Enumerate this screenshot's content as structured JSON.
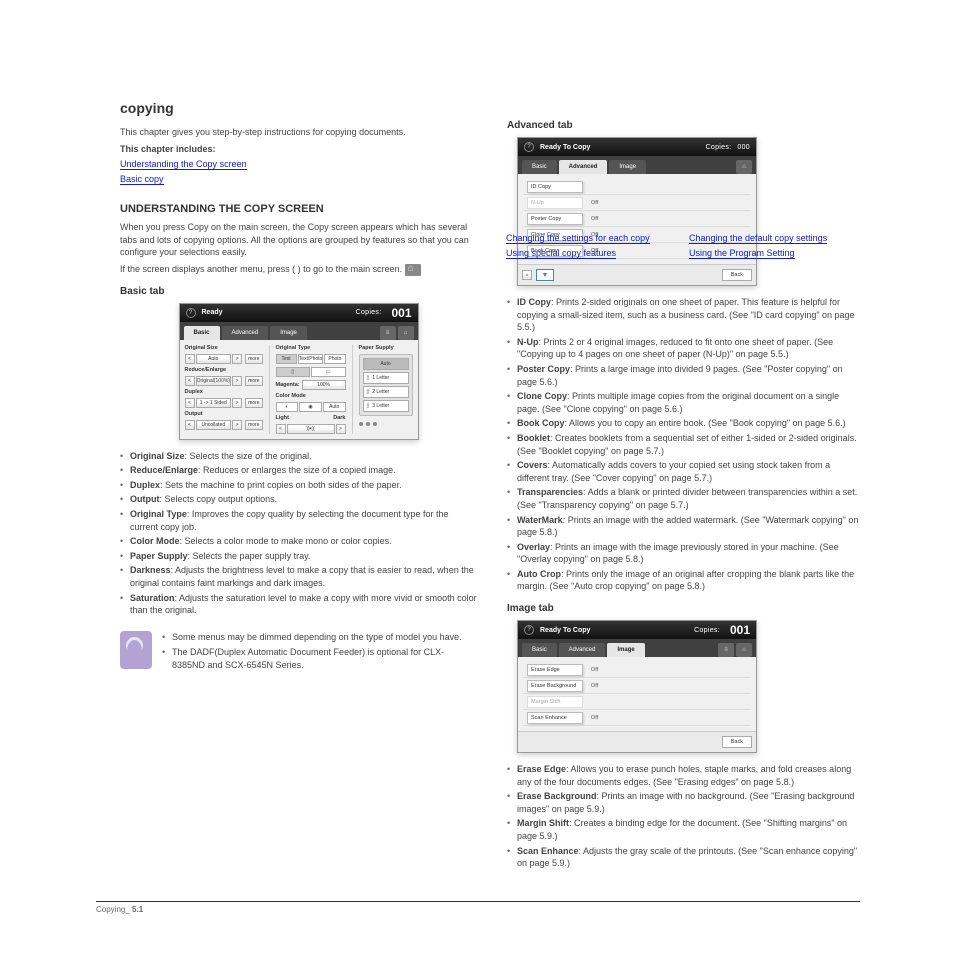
{
  "heading": "copying",
  "intro": "This chapter gives you step-by-step instructions for copying documents.",
  "chapter_includes_label": "This chapter includes:",
  "toc": [
    "Understanding the Copy screen",
    "Basic copy",
    "Changing the settings for each copy",
    "Using special copy features",
    "Changing the default copy settings",
    "Using the Program Setting"
  ],
  "s1": {
    "title": "UNDERSTANDING THE COPY SCREEN",
    "body": [
      "When you press Copy on the main screen, the Copy screen appears which has several tabs and lots of copying options. All the options are grouped by features so that you can configure your selections easily.",
      "If the screen displays another menu, press (    ) to go to the main screen."
    ]
  },
  "basic_tab": {
    "title": "Basic tab",
    "panel": {
      "status": "Ready",
      "copies_label": "Copies:",
      "copies_value": "001",
      "tabs": [
        "Basic",
        "Advanced",
        "Image"
      ],
      "left": {
        "original_size": {
          "label": "Original Size",
          "value": "Auto",
          "more": "more"
        },
        "reduce": {
          "label": "Reduce/Enlarge",
          "value": "Original(100%)",
          "more": "more"
        },
        "duplex": {
          "label": "Duplex",
          "value": "1 -> 1 Sided",
          "more": "more"
        },
        "output": {
          "label": "Output",
          "value": "Uncollated",
          "more": "more"
        }
      },
      "mid": {
        "original_type": {
          "label": "Original Type",
          "seg": [
            "Text",
            "Text/Photo",
            "Photo"
          ]
        },
        "orientation": {
          "label": "Orientation"
        },
        "magenta_label": "Magenta:",
        "magenta_value": "100%",
        "color_mode": {
          "label": "Color Mode",
          "auto": "Auto"
        },
        "darkness": {
          "label": "Light",
          "right": "Dark"
        }
      },
      "right": {
        "label": "Paper Supply",
        "auto": "Auto",
        "trays": [
          "1  Letter",
          "2  Letter",
          "3  Letter"
        ]
      }
    },
    "items": [
      {
        "k": "Original Size",
        "v": "Selects the size of the original."
      },
      {
        "k": "Reduce/Enlarge",
        "v": "Reduces or enlarges the size of a copied image."
      },
      {
        "k": "Duplex",
        "v": "Sets the machine to print copies on both sides of the paper."
      },
      {
        "k": "Output",
        "v": "Selects copy output options."
      },
      {
        "k": "Original Type",
        "v": "Improves the copy quality by selecting the document type for the current copy job."
      },
      {
        "k": "Color Mode",
        "v": "Selects a color mode to make mono or color copies."
      },
      {
        "k": "Paper Supply",
        "v": "Selects the paper supply tray."
      },
      {
        "k": "Darkness",
        "v": "Adjusts the brightness level to make a copy that is easier to read, when the original contains faint markings and dark images."
      },
      {
        "k": "Saturation",
        "v": "Adjusts the saturation level to make a copy with more vivid or smooth color than the original."
      }
    ],
    "note": [
      "Some menus may be dimmed depending on the type of model you have.",
      "The DADF(Duplex Automatic Document Feeder) is optional for CLX-8385ND and SCX-6545N Series."
    ]
  },
  "advanced_tab": {
    "title": "Advanced tab",
    "panel": {
      "status": "Ready To Copy",
      "copies_label": "Copies:",
      "copies_value": "000",
      "tabs": [
        "Basic",
        "Advanced",
        "Image"
      ],
      "rows": [
        {
          "label": "ID Copy",
          "val": ""
        },
        {
          "label": "N-Up",
          "val": "Off",
          "gray": true
        },
        {
          "label": "Poster Copy",
          "val": "Off"
        },
        {
          "label": "Clone Copy",
          "val": "Off"
        },
        {
          "label": "Book Copy",
          "val": "Off"
        }
      ],
      "back": "Back"
    },
    "items": [
      {
        "k": "ID Copy",
        "v": "Prints 2-sided originals on one sheet of paper. This feature is helpful for copying a small-sized item, such as a business card. (See \"ID card copying\" on page 5.5.)"
      },
      {
        "k": "N-Up",
        "v": "Prints 2 or 4 original images, reduced to fit onto one sheet of paper. (See \"Copying up to 4 pages on one sheet of paper (N-Up)\" on page 5.5.)"
      },
      {
        "k": "Poster Copy",
        "v": "Prints a large image into divided 9 pages. (See \"Poster copying\" on page 5.6.)"
      },
      {
        "k": "Clone Copy",
        "v": "Prints multiple image copies from the original document on a single page. (See \"Clone copying\" on page 5.6.)"
      },
      {
        "k": "Book Copy",
        "v": "Allows you to copy an entire book. (See \"Book copying\" on page 5.6.)"
      },
      {
        "k": "Booklet",
        "v": "Creates booklets from a sequential set of either 1-sided or 2-sided originals. (See \"Booklet copying\" on page 5.7.)"
      },
      {
        "k": "Covers",
        "v": "Automatically adds covers to your copied set using stock taken from a different tray. (See \"Cover copying\" on page 5.7.)"
      },
      {
        "k": "Transparencies",
        "v": "Adds a blank or printed divider between transparencies within a set. (See \"Transparency copying\" on page 5.7.)"
      },
      {
        "k": "WaterMark",
        "v": "Prints an image with the added watermark. (See \"Watermark copying\" on page 5.8.)"
      },
      {
        "k": "Overlay",
        "v": "Prints an image with the image previously stored in your machine. (See \"Overlay copying\" on page 5.8.)"
      },
      {
        "k": "Auto Crop",
        "v": "Prints only the image of an original after cropping the blank parts like the margin. (See \"Auto crop copying\" on page 5.8.)"
      }
    ]
  },
  "image_tab": {
    "title": "Image tab",
    "panel": {
      "status": "Ready To Copy",
      "copies_label": "Copies:",
      "copies_value": "001",
      "tabs": [
        "Basic",
        "Advanced",
        "Image"
      ],
      "rows": [
        {
          "label": "Erase Edge",
          "val": "Off"
        },
        {
          "label": "Erase Background",
          "val": "Off"
        },
        {
          "label": "Margin Shift",
          "val": "",
          "gray": true
        },
        {
          "label": "Scan Enhance",
          "val": "Off"
        }
      ],
      "back": "Back"
    },
    "items": [
      {
        "k": "Erase Edge",
        "v": "Allows you to erase punch holes, staple marks, and fold creases along any of the four documents edges. (See \"Erasing edges\" on page 5.8.)"
      },
      {
        "k": "Erase Background",
        "v": "Prints an image with no background. (See \"Erasing background images\" on page 5.9.)"
      },
      {
        "k": "Margin Shift",
        "v": "Creates a binding edge for the document. (See \"Shifting margins\" on page 5.9.)"
      },
      {
        "k": "Scan Enhance",
        "v": "Adjusts the gray scale of the printouts. (See \"Scan enhance copying\" on page 5.9.)"
      }
    ]
  },
  "footer": {
    "label": "Copying_",
    "page": "5.1"
  }
}
